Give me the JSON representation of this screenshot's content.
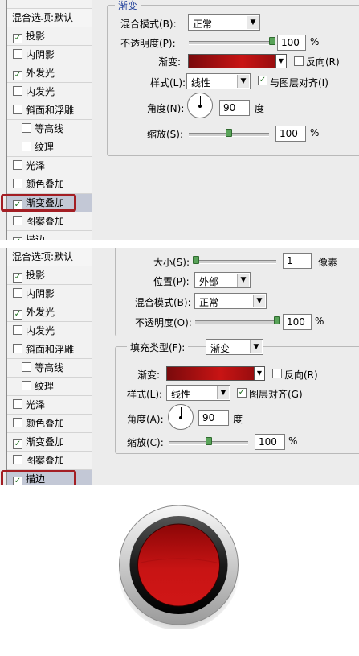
{
  "panel1": {
    "sidebar_top_cut": "样式",
    "sidebar_items": [
      {
        "label": "混合选项:默认",
        "checkbox": false,
        "checked": false,
        "indent": false
      },
      {
        "label": "投影",
        "checkbox": true,
        "checked": true,
        "indent": false
      },
      {
        "label": "内阴影",
        "checkbox": true,
        "checked": false,
        "indent": false
      },
      {
        "label": "外发光",
        "checkbox": true,
        "checked": true,
        "indent": false
      },
      {
        "label": "内发光",
        "checkbox": true,
        "checked": false,
        "indent": false
      },
      {
        "label": "斜面和浮雕",
        "checkbox": true,
        "checked": false,
        "indent": false
      },
      {
        "label": "等高线",
        "checkbox": true,
        "checked": false,
        "indent": true
      },
      {
        "label": "纹理",
        "checkbox": true,
        "checked": false,
        "indent": true
      },
      {
        "label": "光泽",
        "checkbox": true,
        "checked": false,
        "indent": false
      },
      {
        "label": "颜色叠加",
        "checkbox": true,
        "checked": false,
        "indent": false
      },
      {
        "label": "渐变叠加",
        "checkbox": true,
        "checked": true,
        "indent": false,
        "selected": true
      },
      {
        "label": "图案叠加",
        "checkbox": true,
        "checked": false,
        "indent": false
      },
      {
        "label": "描边",
        "checkbox": true,
        "checked": true,
        "indent": false
      }
    ],
    "group_title": "渐变",
    "blend_mode_label": "混合模式(B):",
    "blend_mode_value": "正常",
    "opacity_label": "不透明度(P):",
    "opacity_value": "100",
    "opacity_level": 1.0,
    "percent": "%",
    "gradient_label": "渐变:",
    "reverse_label": "反向(R)",
    "reverse_checked": false,
    "style_label": "样式(L):",
    "style_value": "线性",
    "align_label": "与图层对齐(I)",
    "align_checked": true,
    "angle_label": "角度(N):",
    "angle_value": "90",
    "degree": "度",
    "scale_label": "缩放(S):",
    "scale_value": "100",
    "scale_level": 0.5
  },
  "panel2": {
    "sidebar_items": [
      {
        "label": "混合选项:默认",
        "checkbox": false,
        "checked": false,
        "indent": false
      },
      {
        "label": "投影",
        "checkbox": true,
        "checked": true,
        "indent": false
      },
      {
        "label": "内阴影",
        "checkbox": true,
        "checked": false,
        "indent": false
      },
      {
        "label": "外发光",
        "checkbox": true,
        "checked": true,
        "indent": false
      },
      {
        "label": "内发光",
        "checkbox": true,
        "checked": false,
        "indent": false
      },
      {
        "label": "斜面和浮雕",
        "checkbox": true,
        "checked": false,
        "indent": false
      },
      {
        "label": "等高线",
        "checkbox": true,
        "checked": false,
        "indent": true
      },
      {
        "label": "纹理",
        "checkbox": true,
        "checked": false,
        "indent": true
      },
      {
        "label": "光泽",
        "checkbox": true,
        "checked": false,
        "indent": false
      },
      {
        "label": "颜色叠加",
        "checkbox": true,
        "checked": false,
        "indent": false
      },
      {
        "label": "渐变叠加",
        "checkbox": true,
        "checked": true,
        "indent": false
      },
      {
        "label": "图案叠加",
        "checkbox": true,
        "checked": false,
        "indent": false
      },
      {
        "label": "描边",
        "checkbox": true,
        "checked": true,
        "indent": false,
        "selected": true
      }
    ],
    "size_label": "大小(S):",
    "size_value": "1",
    "size_unit": "像素",
    "size_level": 0.0,
    "position_label": "位置(P):",
    "position_value": "外部",
    "blend_mode_label": "混合模式(B):",
    "blend_mode_value": "正常",
    "opacity_label": "不透明度(O):",
    "opacity_value": "100",
    "opacity_level": 1.0,
    "percent": "%",
    "fill_type_label": "填充类型(F):",
    "fill_type_value": "渐变",
    "gradient_label": "渐变:",
    "reverse_label": "反向(R)",
    "reverse_checked": false,
    "style_label": "样式(L):",
    "style_value": "线性",
    "align_label": "图层对齐(G)",
    "align_checked": true,
    "angle_label": "角度(A):",
    "angle_value": "90",
    "degree": "度",
    "scale_label": "缩放(C):",
    "scale_value": "100",
    "scale_level": 0.5
  },
  "colors": {
    "highlight_box": "#a31e24",
    "button_red": "#c81414",
    "legend_blue": "#1f3f9a"
  }
}
